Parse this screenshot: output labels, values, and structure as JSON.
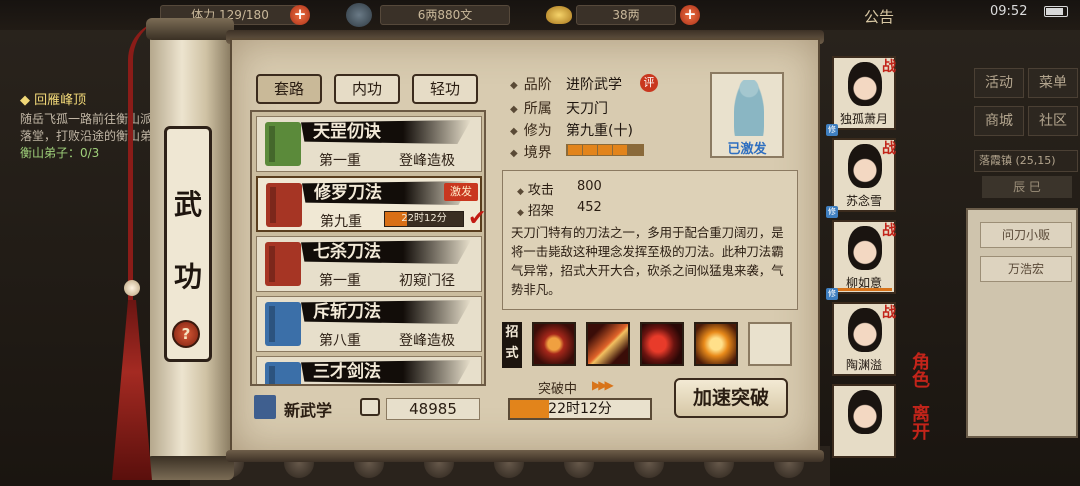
{
  "topbar": {
    "res1": "体力 129/180",
    "res2": "6两880文",
    "res3": "38两",
    "notice": "公告",
    "clock": "09:52"
  },
  "quest": {
    "title": "◆ 回雁峰顶",
    "desc": "随岳飞孤一路前往衡山派羽落堂，打败沿途的衡山弟子",
    "progress": "衡山弟子：0/3"
  },
  "right_panel": {
    "btn1": "活动",
    "btn2": "菜单",
    "btn3": "商城",
    "btn4": "社区",
    "location": "落霞镇 (25,15)",
    "area_tab": "辰 巳",
    "item1": "问刀小贩",
    "item2": "万浩宏"
  },
  "scroll": {
    "title1": "武",
    "title2": "功",
    "help": "?"
  },
  "tabs": [
    {
      "label": "套路",
      "active": true
    },
    {
      "label": "内功",
      "active": false
    },
    {
      "label": "轻功",
      "active": false
    }
  ],
  "skills": [
    {
      "name": "天罡仞诀",
      "level": "第一重",
      "rank": "登峰造极",
      "book_color": "#5b8a3a"
    },
    {
      "name": "修罗刀法",
      "level": "第九重",
      "badge": "激发",
      "timer": "22时12分",
      "timer_progress": 0.28,
      "book_color": "#a63524",
      "selected": true
    },
    {
      "name": "七杀刀法",
      "level": "第一重",
      "rank": "初窥门径",
      "book_color": "#a63524"
    },
    {
      "name": "斥斩刀法",
      "level": "第八重",
      "rank": "登峰造极",
      "book_color": "#3b6fa8"
    },
    {
      "name": "三才剑法",
      "level": "",
      "rank": "",
      "book_color": "#3b6fa8"
    }
  ],
  "footer": {
    "new_label": "新武学",
    "points": "48985"
  },
  "detail": {
    "grade_key": "品阶",
    "grade": "进阶武学",
    "eval": "评",
    "sect_key": "所属",
    "sect": "天刀门",
    "cult_key": "修为",
    "cult": "第九重(十)",
    "realm_key": "境界",
    "realm_progress": 0.7,
    "activated": "已激发",
    "attack_key": "攻击",
    "attack": "800",
    "parry_key": "招架",
    "parry": "452",
    "description": "天刀门特有的刀法之一，多用于配合重刀阔刃，是将一击毙敌这种理念发挥至极的刀法。此种刀法霸气异常，招式大开大合，砍杀之间似猛鬼来袭，气势非凡。",
    "moves_label": "招式",
    "breakthrough_label": "突破中",
    "breakthrough_timer": "22时12分",
    "breakthrough_progress": 0.28,
    "speed_button": "加速突破"
  },
  "party": [
    {
      "name": "独孤萧月",
      "fight": "战"
    },
    {
      "name": "苏念雪",
      "fight": "战"
    },
    {
      "name": "柳如意",
      "fight": "战"
    },
    {
      "name": "陶渊溢",
      "fight": "战"
    },
    {
      "name": "",
      "fight": ""
    }
  ],
  "side": {
    "role": "角色",
    "leave": "离开"
  }
}
